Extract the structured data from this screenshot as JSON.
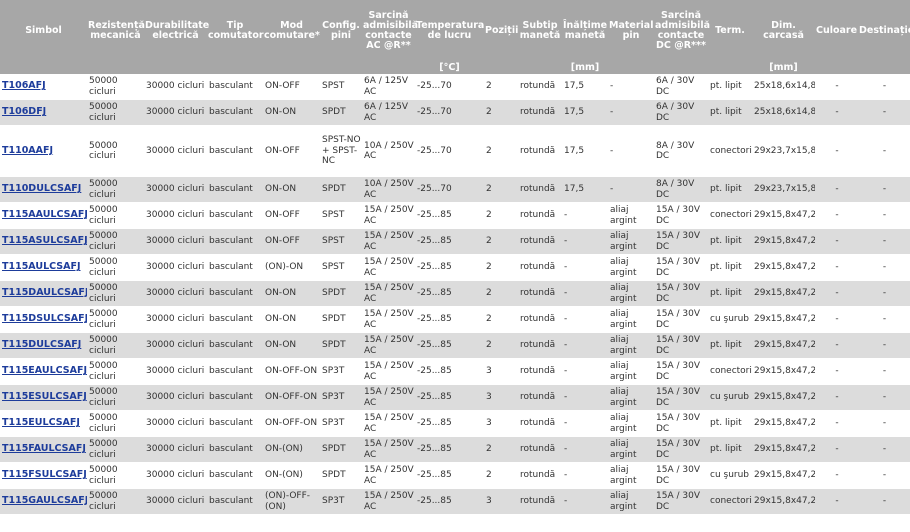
{
  "headers": [
    "Simbol",
    "Rezistență mecanică",
    "Durabilitate electrică",
    "Tip comutator",
    "Mod comutare*",
    "Config. pini",
    "Sarcină admisibilă contacte AC @R**",
    "Temperatura de lucru",
    "Poziții",
    "Subtip manetă",
    "Înălțime manetă",
    "Material pin",
    "Sarcină admisibilă contacte DC @R***",
    "Term.",
    "Dim. carcasă",
    "Culoare",
    "Destinație"
  ],
  "units": {
    "temp": "[°C]",
    "height": "[mm]",
    "dim": "[mm]"
  },
  "rows": [
    {
      "symbol": "T106AFJ",
      "mech": "50000 cicluri",
      "elec": "30000 cicluri",
      "type": "basculant",
      "mode": "ON-OFF",
      "pins": "SPST",
      "ac": "6A / 125V AC",
      "temp": "-25...70",
      "pos": "2",
      "subtype": "rotundă",
      "height": "17,5",
      "material": "-",
      "dc": "6A / 30V DC",
      "term": "pt. lipit",
      "dim": "25x18,6x14,8",
      "color": "-",
      "dest": "-"
    },
    {
      "symbol": "T106DFJ",
      "mech": "50000 cicluri",
      "elec": "30000 cicluri",
      "type": "basculant",
      "mode": "ON-ON",
      "pins": "SPDT",
      "ac": "6A / 125V AC",
      "temp": "-25...70",
      "pos": "2",
      "subtype": "rotundă",
      "height": "17,5",
      "material": "-",
      "dc": "6A / 30V DC",
      "term": "pt. lipit",
      "dim": "25x18,6x14,8",
      "color": "-",
      "dest": "-"
    },
    {
      "symbol": "T110AAFJ",
      "mech": "50000 cicluri",
      "elec": "30000 cicluri",
      "type": "basculant",
      "mode": "ON-OFF",
      "pins": "SPST-NO + SPST-NC",
      "ac": "10A / 250V AC",
      "temp": "-25...70",
      "pos": "2",
      "subtype": "rotundă",
      "height": "17,5",
      "material": "-",
      "dc": "8A / 30V DC",
      "term": "conectori",
      "dim": "29x23,7x15,8",
      "color": "-",
      "dest": "-",
      "tall": true
    },
    {
      "symbol": "T110DULCSAFJ",
      "mech": "50000 cicluri",
      "elec": "30000 cicluri",
      "type": "basculant",
      "mode": "ON-ON",
      "pins": "SPDT",
      "ac": "10A / 250V AC",
      "temp": "-25...70",
      "pos": "2",
      "subtype": "rotundă",
      "height": "17,5",
      "material": "-",
      "dc": "8A / 30V DC",
      "term": "pt. lipit",
      "dim": "29x23,7x15,8",
      "color": "-",
      "dest": "-"
    },
    {
      "symbol": "T115AAULCSAFJ",
      "mech": "50000 cicluri",
      "elec": "30000 cicluri",
      "type": "basculant",
      "mode": "ON-OFF",
      "pins": "SPST",
      "ac": "15A / 250V AC",
      "temp": "-25...85",
      "pos": "2",
      "subtype": "rotundă",
      "height": "-",
      "material": "aliaj argint",
      "dc": "15A / 30V DC",
      "term": "conectori",
      "dim": "29x15,8x47,2",
      "color": "-",
      "dest": "-"
    },
    {
      "symbol": "T115ASULCSAFJ",
      "mech": "50000 cicluri",
      "elec": "30000 cicluri",
      "type": "basculant",
      "mode": "ON-OFF",
      "pins": "SPST",
      "ac": "15A / 250V AC",
      "temp": "-25...85",
      "pos": "2",
      "subtype": "rotundă",
      "height": "-",
      "material": "aliaj argint",
      "dc": "15A / 30V DC",
      "term": "pt. lipit",
      "dim": "29x15,8x47,2",
      "color": "-",
      "dest": "-"
    },
    {
      "symbol": "T115AULCSAFJ",
      "mech": "50000 cicluri",
      "elec": "30000 cicluri",
      "type": "basculant",
      "mode": "(ON)-ON",
      "pins": "SPST",
      "ac": "15A / 250V AC",
      "temp": "-25...85",
      "pos": "2",
      "subtype": "rotundă",
      "height": "-",
      "material": "aliaj argint",
      "dc": "15A / 30V DC",
      "term": "pt. lipit",
      "dim": "29x15,8x47,2",
      "color": "-",
      "dest": "-"
    },
    {
      "symbol": "T115DAULCSAFJ",
      "mech": "50000 cicluri",
      "elec": "30000 cicluri",
      "type": "basculant",
      "mode": "ON-ON",
      "pins": "SPDT",
      "ac": "15A / 250V AC",
      "temp": "-25...85",
      "pos": "2",
      "subtype": "rotundă",
      "height": "-",
      "material": "aliaj argint",
      "dc": "15A / 30V DC",
      "term": "pt. lipit",
      "dim": "29x15,8x47,2",
      "color": "-",
      "dest": "-"
    },
    {
      "symbol": "T115DSULCSAFJ",
      "mech": "50000 cicluri",
      "elec": "30000 cicluri",
      "type": "basculant",
      "mode": "ON-ON",
      "pins": "SPDT",
      "ac": "15A / 250V AC",
      "temp": "-25...85",
      "pos": "2",
      "subtype": "rotundă",
      "height": "-",
      "material": "aliaj argint",
      "dc": "15A / 30V DC",
      "term": "cu şurub",
      "dim": "29x15,8x47,2",
      "color": "-",
      "dest": "-"
    },
    {
      "symbol": "T115DULCSAFJ",
      "mech": "50000 cicluri",
      "elec": "30000 cicluri",
      "type": "basculant",
      "mode": "ON-ON",
      "pins": "SPDT",
      "ac": "15A / 250V AC",
      "temp": "-25...85",
      "pos": "2",
      "subtype": "rotundă",
      "height": "-",
      "material": "aliaj argint",
      "dc": "15A / 30V DC",
      "term": "pt. lipit",
      "dim": "29x15,8x47,2",
      "color": "-",
      "dest": "-"
    },
    {
      "symbol": "T115EAULCSAFJ",
      "mech": "50000 cicluri",
      "elec": "30000 cicluri",
      "type": "basculant",
      "mode": "ON-OFF-ON",
      "pins": "SP3T",
      "ac": "15A / 250V AC",
      "temp": "-25...85",
      "pos": "3",
      "subtype": "rotundă",
      "height": "-",
      "material": "aliaj argint",
      "dc": "15A / 30V DC",
      "term": "conectori",
      "dim": "29x15,8x47,2",
      "color": "-",
      "dest": "-"
    },
    {
      "symbol": "T115ESULCSAFJ",
      "mech": "50000 cicluri",
      "elec": "30000 cicluri",
      "type": "basculant",
      "mode": "ON-OFF-ON",
      "pins": "SP3T",
      "ac": "15A / 250V AC",
      "temp": "-25...85",
      "pos": "3",
      "subtype": "rotundă",
      "height": "-",
      "material": "aliaj argint",
      "dc": "15A / 30V DC",
      "term": "cu şurub",
      "dim": "29x15,8x47,2",
      "color": "-",
      "dest": "-"
    },
    {
      "symbol": "T115EULCSAFJ",
      "mech": "50000 cicluri",
      "elec": "30000 cicluri",
      "type": "basculant",
      "mode": "ON-OFF-ON",
      "pins": "SP3T",
      "ac": "15A / 250V AC",
      "temp": "-25...85",
      "pos": "3",
      "subtype": "rotundă",
      "height": "-",
      "material": "aliaj argint",
      "dc": "15A / 30V DC",
      "term": "pt. lipit",
      "dim": "29x15,8x47,2",
      "color": "-",
      "dest": "-"
    },
    {
      "symbol": "T115FAULCSAFJ",
      "mech": "50000 cicluri",
      "elec": "30000 cicluri",
      "type": "basculant",
      "mode": "ON-(ON)",
      "pins": "SPDT",
      "ac": "15A / 250V AC",
      "temp": "-25...85",
      "pos": "2",
      "subtype": "rotundă",
      "height": "-",
      "material": "aliaj argint",
      "dc": "15A / 30V DC",
      "term": "pt. lipit",
      "dim": "29x15,8x47,2",
      "color": "-",
      "dest": "-"
    },
    {
      "symbol": "T115FSULCSAFJ",
      "mech": "50000 cicluri",
      "elec": "30000 cicluri",
      "type": "basculant",
      "mode": "ON-(ON)",
      "pins": "SPDT",
      "ac": "15A / 250V AC",
      "temp": "-25...85",
      "pos": "2",
      "subtype": "rotundă",
      "height": "-",
      "material": "aliaj argint",
      "dc": "15A / 30V DC",
      "term": "cu şurub",
      "dim": "29x15,8x47,2",
      "color": "-",
      "dest": "-"
    },
    {
      "symbol": "T115GAULCSAFJ",
      "mech": "50000 cicluri",
      "elec": "30000 cicluri",
      "type": "basculant",
      "mode": "(ON)-OFF-(ON)",
      "pins": "SP3T",
      "ac": "15A / 250V AC",
      "temp": "-25...85",
      "pos": "3",
      "subtype": "rotundă",
      "height": "-",
      "material": "aliaj argint",
      "dc": "15A / 30V DC",
      "term": "conectori",
      "dim": "29x15,8x47,2",
      "color": "-",
      "dest": "-"
    }
  ]
}
